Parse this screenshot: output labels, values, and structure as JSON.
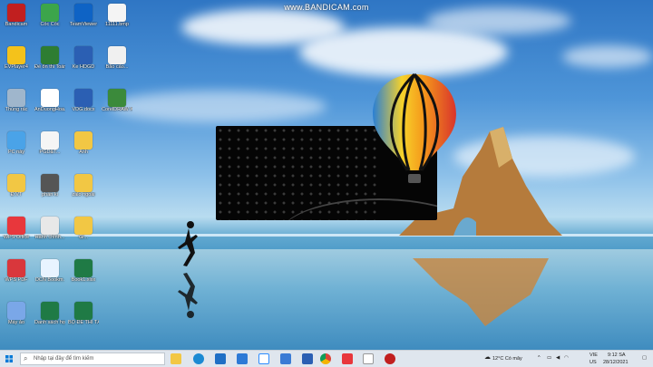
{
  "watermark": "www.BANDICAM.com",
  "desktop_icons": [
    {
      "label": "Bandicam",
      "color": "#c11f1f",
      "name": "bandicam-icon"
    },
    {
      "label": "Cốc Cốc",
      "color": "#3ca54b",
      "name": "coccoc-icon"
    },
    {
      "label": "TeamViewer",
      "color": "#0e63c5",
      "name": "teamviewer-icon"
    },
    {
      "label": "11111.bmp",
      "color": "#f4f4f4",
      "name": "bmp-file-icon"
    },
    {
      "label": "EVPlayer4",
      "color": "#f4c21b",
      "name": "evplayer-icon"
    },
    {
      "label": "Đề ôn thi Toán...",
      "color": "#2e7d32",
      "name": "document-icon"
    },
    {
      "label": "Ke HDGD",
      "color": "#2b5fb3",
      "name": "word-doc-icon"
    },
    {
      "label": "Bảo cáo...",
      "color": "#f0f0f0",
      "name": "word-doc-icon"
    },
    {
      "label": "Thùng rác",
      "color": "#9fb6cc",
      "name": "recycle-bin-icon"
    },
    {
      "label": "AnDuongHoa...",
      "color": "#ffffff",
      "name": "word-doc-icon"
    },
    {
      "label": "VDG.docx",
      "color": "#2b5fb3",
      "name": "word-doc-icon"
    },
    {
      "label": "CorelDRAW X8",
      "color": "#3b8a3b",
      "name": "coreldraw-icon"
    },
    {
      "label": "PC này",
      "color": "#4aa3e8",
      "name": "this-pc-icon"
    },
    {
      "label": "PGD&T...",
      "color": "#f5f5f5",
      "name": "pptx-file-icon"
    },
    {
      "label": "Anh",
      "color": "#f2c744",
      "name": "folder-icon"
    },
    {
      "label": "Đ.VT",
      "color": "#f2c744",
      "name": "folder-icon"
    },
    {
      "label": "phần ki",
      "color": "#555555",
      "name": "file-icon"
    },
    {
      "label": "zalo ngoài",
      "color": "#f2c744",
      "name": "folder-icon"
    },
    {
      "label": "WPS Office",
      "color": "#e8373c",
      "name": "wps-office-icon"
    },
    {
      "label": "Hành chính...",
      "color": "#e8e8e8",
      "name": "app-icon"
    },
    {
      "label": "Gi...",
      "color": "#f2c744",
      "name": "folder-icon"
    },
    {
      "label": "WPS PDF",
      "color": "#d9373c",
      "name": "wps-pdf-icon"
    },
    {
      "label": "DCN Bookm.",
      "color": "#e8f4ff",
      "name": "app-icon"
    },
    {
      "label": "Book1.xlsx",
      "color": "#1f7a45",
      "name": "excel-file-icon"
    },
    {
      "label": "Máy ảo",
      "color": "#7aa7e8",
      "name": "app-icon"
    },
    {
      "label": "Danh sách học sinh...",
      "color": "#1f7a45",
      "name": "excel-file-icon"
    },
    {
      "label": "BỘ ĐỀ THI TẤT CẢ...",
      "color": "#1f7a45",
      "name": "excel-file-icon"
    }
  ],
  "taskbar": {
    "search_placeholder": "Nhập tại đây để tìm kiếm",
    "weather": "12°C  Có mây",
    "lang_top": "VIE",
    "lang_bottom": "US",
    "time": "9:12 SA",
    "date": "28/12/2021"
  }
}
